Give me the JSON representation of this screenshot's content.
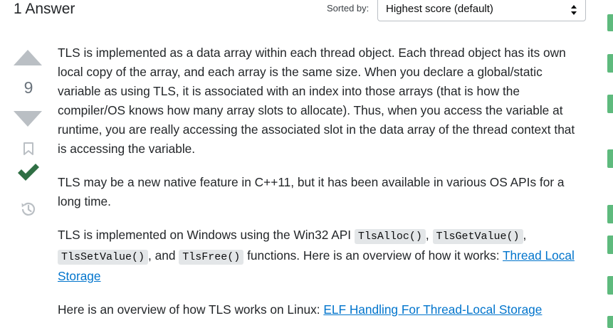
{
  "header": {
    "answers_count": "1 Answer",
    "sort_label": "Sorted by:",
    "sort_selected": "Highest score (default)"
  },
  "vote": {
    "score": "9"
  },
  "answer": {
    "p1": "TLS is implemented as a data array within each thread object. Each thread object has its own local copy of the array, and each array is the same size. When you declare a global/static variable as using TLS, it is associated with an index into those arrays (that is how the compiler/OS knows how many array slots to allocate). Thus, when you access the variable at runtime, you are really accessing the associated slot in the data array of the thread context that is accessing the variable.",
    "p2": "TLS may be a new native feature in C++11, but it has been available in various OS APIs for a long time.",
    "p3_intro": "TLS is implemented on Windows using the Win32 API ",
    "code_alloc": "TlsAlloc()",
    "sep1": ", ",
    "code_get": "TlsGetValue()",
    "sep2": ", ",
    "code_set": "TlsSetValue()",
    "sep3": ", and ",
    "code_free": "TlsFree()",
    "p3_mid": " functions. Here is an overview of how it works: ",
    "link_windows": "Thread Local Storage",
    "p4_intro": "Here is an overview of how TLS works on Linux: ",
    "link_linux": "ELF Handling For Thread-Local Storage"
  },
  "colors": {
    "accepted_green": "#2f6f44",
    "strip_green": "#5eba7d",
    "link_blue": "#0074cc",
    "vote_gray": "#babfc4"
  }
}
